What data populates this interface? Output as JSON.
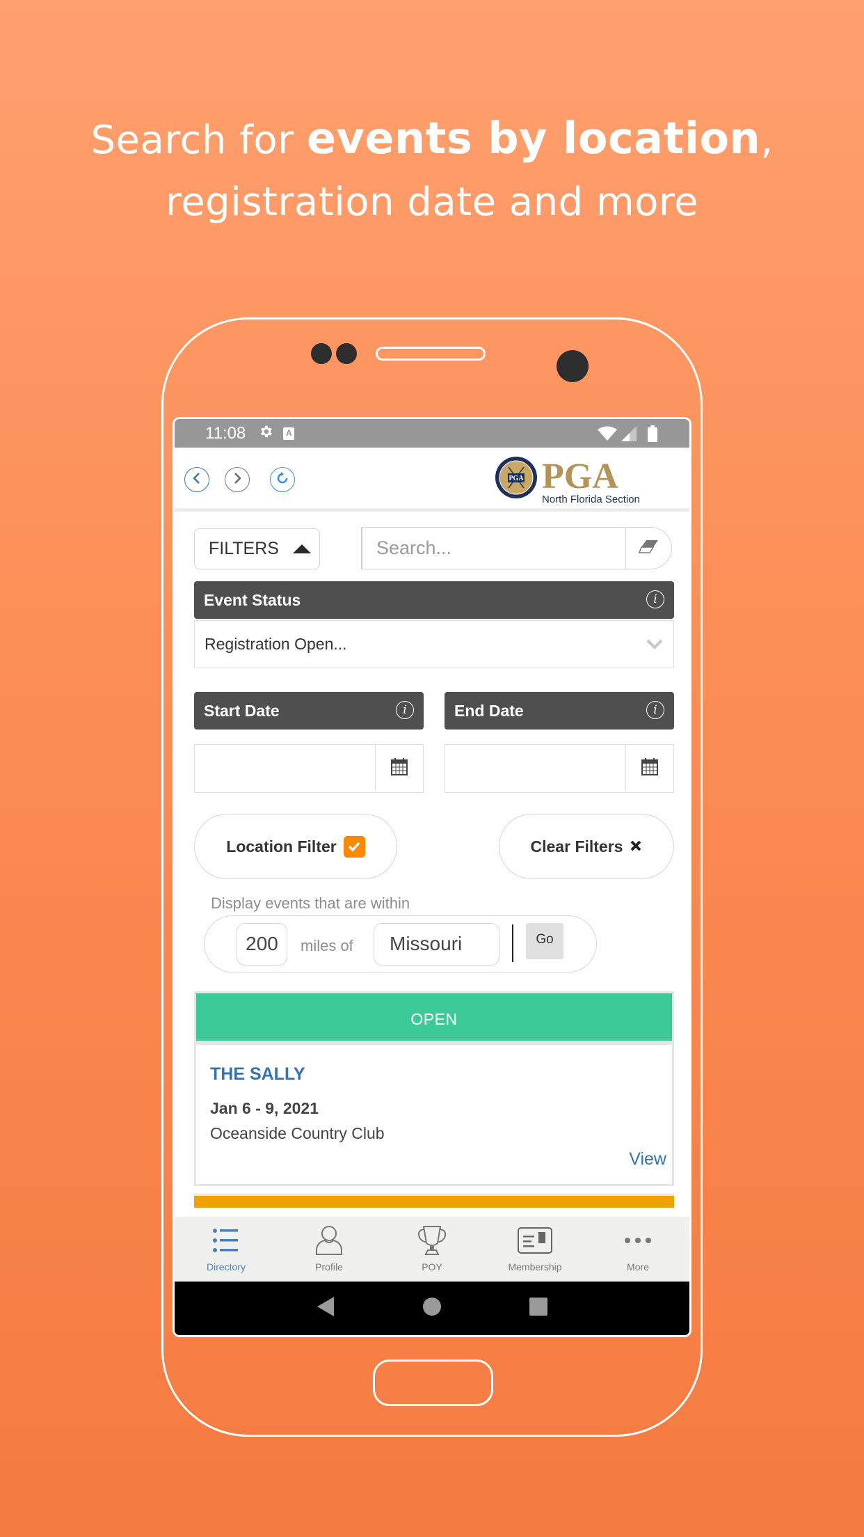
{
  "headline": {
    "line1_prefix": "Search for ",
    "line1_bold": "events by location",
    "line1_suffix": ",",
    "line2": "registration date and more"
  },
  "statusbar": {
    "time": "11:08",
    "icons": [
      "gear-icon",
      "keyboard-a-icon",
      "wifi-icon",
      "signal-icon",
      "battery-icon"
    ]
  },
  "navbar": {
    "back_icon": "chevron-left-icon",
    "forward_icon": "chevron-right-icon",
    "refresh_icon": "refresh-icon",
    "logo": {
      "wordmark": "PGA",
      "seal_text": "PGA",
      "section": "North Florida Section"
    }
  },
  "filters": {
    "toggle_label": "FILTERS",
    "search_placeholder": "Search...",
    "search_value": "",
    "event_status": {
      "header": "Event Status",
      "selected": "Registration Open..."
    },
    "start_date": {
      "header": "Start Date",
      "value": ""
    },
    "end_date": {
      "header": "End Date",
      "value": ""
    },
    "location_filter": {
      "label": "Location Filter",
      "checked": true
    },
    "clear_filters": {
      "label": "Clear Filters"
    },
    "radius": {
      "label": "Display events that are within",
      "miles": "200",
      "miles_of_label": "miles of",
      "place": "Missouri",
      "go_label": "Go"
    }
  },
  "events": [
    {
      "status": "OPEN",
      "status_color": "#3CCB98",
      "title": "THE SALLY",
      "dates": "Jan 6 - 9, 2021",
      "venue": "Oceanside Country Club",
      "view_label": "View"
    }
  ],
  "next_event_status_color": "#F0A000",
  "tabbar": {
    "items": [
      {
        "label": "Directory",
        "icon": "list-icon",
        "active": true
      },
      {
        "label": "Profile",
        "icon": "person-icon",
        "active": false
      },
      {
        "label": "POY",
        "icon": "trophy-icon",
        "active": false
      },
      {
        "label": "Membership",
        "icon": "membership-card-icon",
        "active": false
      },
      {
        "label": "More",
        "icon": "more-dots-icon",
        "active": false
      }
    ]
  },
  "colors": {
    "accent_blue": "#3274B3",
    "checkbox_orange": "#FF8A00",
    "header_dark": "#4F4F4F",
    "pga_gold": "#B39456"
  }
}
